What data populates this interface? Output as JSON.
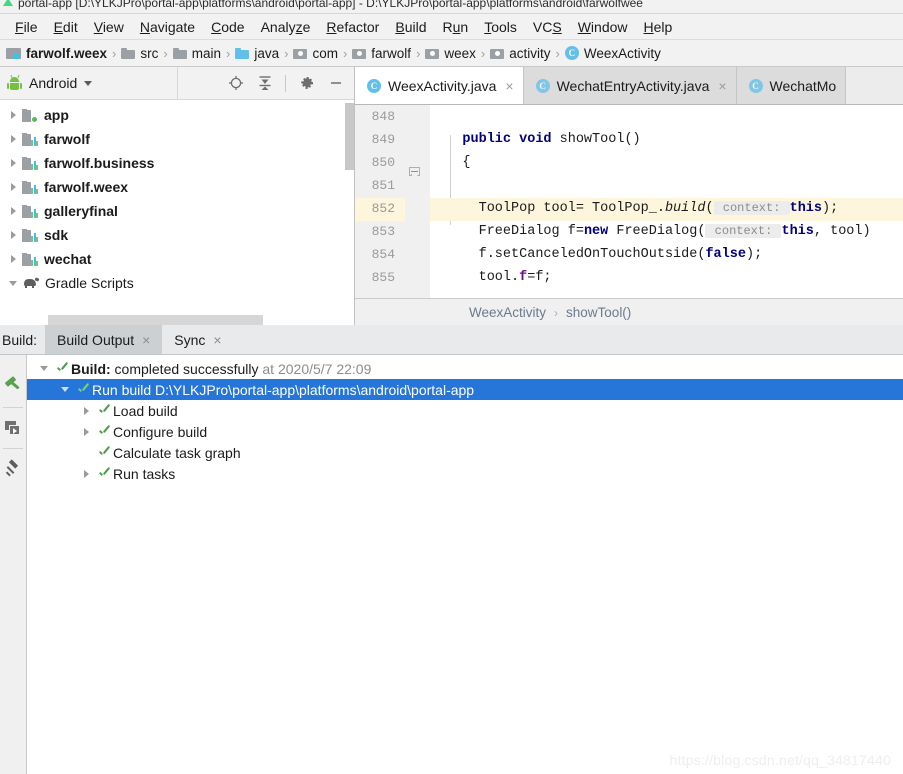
{
  "window": {
    "title": "portal-app [D:\\YLKJPro\\portal-app\\platforms\\android\\portal-app] - D:\\YLKJPro\\portal-app\\platforms\\android\\farwolfwee"
  },
  "menubar": {
    "items": [
      {
        "label": "File",
        "mnemonic": "F"
      },
      {
        "label": "Edit",
        "mnemonic": "E"
      },
      {
        "label": "View",
        "mnemonic": "V"
      },
      {
        "label": "Navigate",
        "mnemonic": "N"
      },
      {
        "label": "Code",
        "mnemonic": "C"
      },
      {
        "label": "Analyze",
        "mnemonic": "z"
      },
      {
        "label": "Refactor",
        "mnemonic": "R"
      },
      {
        "label": "Build",
        "mnemonic": "B"
      },
      {
        "label": "Run",
        "mnemonic": "u"
      },
      {
        "label": "Tools",
        "mnemonic": "T"
      },
      {
        "label": "VCS",
        "mnemonic": "S"
      },
      {
        "label": "Window",
        "mnemonic": "W"
      },
      {
        "label": "Help",
        "mnemonic": "H"
      }
    ]
  },
  "breadcrumb": {
    "separator": "›",
    "items": [
      {
        "label": "farwolf.weex",
        "icon": "module-icon",
        "bold": true
      },
      {
        "label": "src",
        "icon": "folder-gray-icon",
        "bold": false
      },
      {
        "label": "main",
        "icon": "folder-gray-icon",
        "bold": false
      },
      {
        "label": "java",
        "icon": "folder-blue-icon",
        "bold": false
      },
      {
        "label": "com",
        "icon": "package-icon",
        "bold": false
      },
      {
        "label": "farwolf",
        "icon": "package-icon",
        "bold": false
      },
      {
        "label": "weex",
        "icon": "package-icon",
        "bold": false
      },
      {
        "label": "activity",
        "icon": "package-icon",
        "bold": false
      },
      {
        "label": "WeexActivity",
        "icon": "class-icon",
        "bold": false
      }
    ]
  },
  "project_panel": {
    "title": "Android",
    "toolbar": [
      {
        "name": "locate-icon",
        "glyph": "target"
      },
      {
        "name": "collapse-all-icon",
        "glyph": "collapse"
      },
      {
        "name": "settings-gear-icon",
        "glyph": "gear"
      },
      {
        "name": "hide-icon",
        "glyph": "minus"
      }
    ],
    "tree": [
      {
        "label": "app",
        "expandable": true,
        "icon": "module-green-dot-icon"
      },
      {
        "label": "farwolf",
        "expandable": true,
        "icon": "module-library-icon"
      },
      {
        "label": "farwolf.business",
        "expandable": true,
        "icon": "module-library-icon"
      },
      {
        "label": "farwolf.weex",
        "expandable": true,
        "icon": "module-library-icon"
      },
      {
        "label": "galleryfinal",
        "expandable": true,
        "icon": "module-library-icon"
      },
      {
        "label": "sdk",
        "expandable": true,
        "icon": "module-library-icon"
      },
      {
        "label": "wechat",
        "expandable": true,
        "icon": "module-library-icon"
      },
      {
        "label": "Gradle Scripts",
        "expandable": true,
        "expanded": true,
        "icon": "gradle-elephant-icon",
        "bold": false
      }
    ]
  },
  "editor": {
    "tabs": [
      {
        "label": "WeexActivity.java",
        "active": true,
        "closable": true
      },
      {
        "label": "WechatEntryActivity.java",
        "active": false,
        "closable": true
      },
      {
        "label": "WechatMo",
        "active": false,
        "closable": false
      }
    ],
    "first_line_number": 848,
    "highlighted_line": 852,
    "lines": [
      {
        "number": "848",
        "segments": []
      },
      {
        "number": "849",
        "segments": [
          {
            "t": "    ",
            "c": "plain"
          },
          {
            "t": "public",
            "c": "kw"
          },
          {
            "t": " ",
            "c": "plain"
          },
          {
            "t": "void",
            "c": "kw"
          },
          {
            "t": " showTool()",
            "c": "plain"
          }
        ]
      },
      {
        "number": "850",
        "segments": [
          {
            "t": "    {",
            "c": "plain"
          }
        ]
      },
      {
        "number": "851",
        "segments": []
      },
      {
        "number": "852",
        "segments": [
          {
            "t": "      ToolPop tool= ToolPop_.",
            "c": "plain"
          },
          {
            "t": "build",
            "c": "mtd"
          },
          {
            "t": "(",
            "c": "plain"
          },
          {
            "t": " context: ",
            "c": "hint"
          },
          {
            "t": "this",
            "c": "kw"
          },
          {
            "t": ");",
            "c": "plain"
          }
        ]
      },
      {
        "number": "853",
        "segments": [
          {
            "t": "      FreeDialog f=",
            "c": "plain"
          },
          {
            "t": "new",
            "c": "kw"
          },
          {
            "t": " FreeDialog(",
            "c": "plain"
          },
          {
            "t": " context: ",
            "c": "hint"
          },
          {
            "t": "this",
            "c": "kw"
          },
          {
            "t": ", tool)",
            "c": "plain"
          }
        ]
      },
      {
        "number": "854",
        "segments": [
          {
            "t": "      f.setCanceledOnTouchOutside(",
            "c": "plain"
          },
          {
            "t": "false",
            "c": "kw"
          },
          {
            "t": ");",
            "c": "plain"
          }
        ]
      },
      {
        "number": "855",
        "segments": [
          {
            "t": "      tool.",
            "c": "plain"
          },
          {
            "t": "f",
            "c": "fld"
          },
          {
            "t": "=f;",
            "c": "plain"
          }
        ]
      }
    ],
    "status_breadcrumb": {
      "class": "WeexActivity",
      "separator": "›",
      "method": "showTool()"
    }
  },
  "build_window": {
    "label": "Build:",
    "tabs": [
      {
        "label": "Build Output",
        "active": true,
        "closable": true
      },
      {
        "label": "Sync",
        "active": false,
        "closable": true
      }
    ],
    "sidebar_icons": [
      {
        "name": "build-hammer-icon"
      },
      {
        "name": "run-console-icon"
      },
      {
        "name": "pin-icon"
      }
    ],
    "tree": [
      {
        "level": 0,
        "twisty": "down",
        "status": "success",
        "text_bold": "Build:",
        "text": " completed successfully",
        "text_dim": " at 2020/5/7 22:09",
        "selected": false
      },
      {
        "level": 1,
        "twisty": "down",
        "status": "success",
        "text_bold": "",
        "text": "Run build D:\\YLKJPro\\portal-app\\platforms\\android\\portal-app",
        "text_dim": "",
        "selected": true
      },
      {
        "level": 2,
        "twisty": "right",
        "status": "success",
        "text_bold": "",
        "text": "Load build",
        "text_dim": "",
        "selected": false
      },
      {
        "level": 2,
        "twisty": "right",
        "status": "success",
        "text_bold": "",
        "text": "Configure build",
        "text_dim": "",
        "selected": false
      },
      {
        "level": 2,
        "twisty": "none",
        "status": "success",
        "text_bold": "",
        "text": "Calculate task graph",
        "text_dim": "",
        "selected": false
      },
      {
        "level": 2,
        "twisty": "right",
        "status": "success",
        "text_bold": "",
        "text": "Run tasks",
        "text_dim": "",
        "selected": false
      }
    ]
  },
  "watermark": {
    "text": "https://blog.csdn.net/qq_34817440"
  },
  "colors": {
    "selection_blue": "#2675d9",
    "success_green": "#4a9e42",
    "highlight_yellow": "#fdf6dd",
    "keyword_navy": "#000080",
    "field_purple": "#660e7a",
    "accent_cyan": "#62c0e8"
  }
}
